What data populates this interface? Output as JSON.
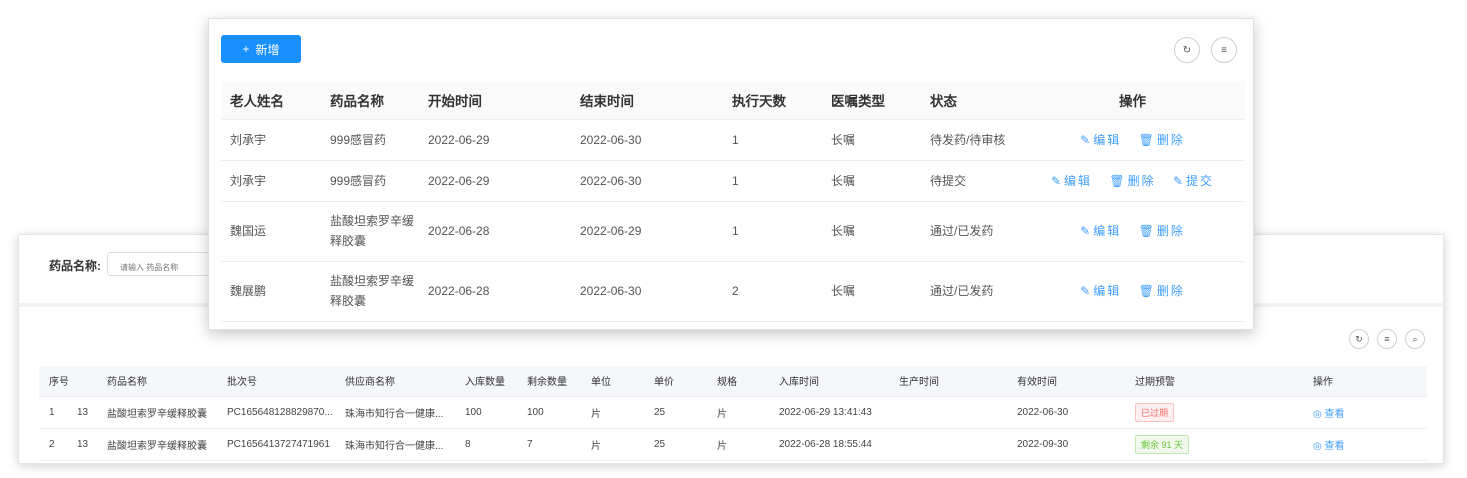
{
  "inventory": {
    "filter": {
      "label": "药品名称:",
      "placeholder": "请输入 药品名称"
    },
    "tools": [
      "refresh-icon",
      "settings-icon",
      "search-icon"
    ],
    "columns": [
      "序号",
      "药品名称",
      "批次号",
      "供应商名称",
      "入库数量",
      "剩余数量",
      "单位",
      "单价",
      "规格",
      "入库时间",
      "生产时间",
      "有效时间",
      "过期预警",
      "操作"
    ],
    "rows": [
      {
        "index": "1",
        "id": "13",
        "name": "盐酸坦索罗辛缓释胶囊",
        "batch": "PC165648128829870...",
        "supplier": "珠海市知行合一健康...",
        "in_qty": "100",
        "left_qty": "100",
        "unit": "片",
        "price": "25",
        "spec": "片",
        "in_time": "2022-06-29 13:41:43",
        "made": "",
        "expire": "2022-06-30",
        "warn": "已过期",
        "warn_type": "red",
        "action": "查看"
      },
      {
        "index": "2",
        "id": "13",
        "name": "盐酸坦索罗辛缓释胶囊",
        "batch": "PC1656413727471961",
        "supplier": "珠海市知行合一健康...",
        "in_qty": "8",
        "left_qty": "7",
        "unit": "片",
        "price": "25",
        "spec": "片",
        "in_time": "2022-06-28 18:55:44",
        "made": "",
        "expire": "2022-09-30",
        "warn": "剩余 91 天",
        "warn_type": "green",
        "action": "查看"
      }
    ]
  },
  "orders": {
    "add_label": "新增",
    "tools": [
      "refresh-icon",
      "settings-icon"
    ],
    "columns": [
      "老人姓名",
      "药品名称",
      "开始时间",
      "结束时间",
      "执行天数",
      "医嘱类型",
      "状态",
      "操作"
    ],
    "rows": [
      {
        "name": "刘承宇",
        "drug": "999感冒药",
        "start": "2022-06-29",
        "end": "2022-06-30",
        "days": "1",
        "type": "长嘱",
        "status": "待发药/待审核",
        "actions": [
          "编辑",
          "删除"
        ]
      },
      {
        "name": "刘承宇",
        "drug": "999感冒药",
        "start": "2022-06-29",
        "end": "2022-06-30",
        "days": "1",
        "type": "长嘱",
        "status": "待提交",
        "actions": [
          "编辑",
          "删除",
          "提交"
        ]
      },
      {
        "name": "魏国运",
        "drug": "盐酸坦索罗辛缓释胶囊",
        "start": "2022-06-28",
        "end": "2022-06-29",
        "days": "1",
        "type": "长嘱",
        "status": "通过/已发药",
        "actions": [
          "编辑",
          "删除"
        ]
      },
      {
        "name": "魏展鹏",
        "drug": "盐酸坦索罗辛缓释胶囊",
        "start": "2022-06-28",
        "end": "2022-06-30",
        "days": "2",
        "type": "长嘱",
        "status": "通过/已发药",
        "actions": [
          "编辑",
          "删除"
        ]
      }
    ]
  },
  "colors": {
    "primary": "#1890ff",
    "link": "#409eff",
    "expired": "#f56c6c",
    "ok": "#67c23a"
  }
}
